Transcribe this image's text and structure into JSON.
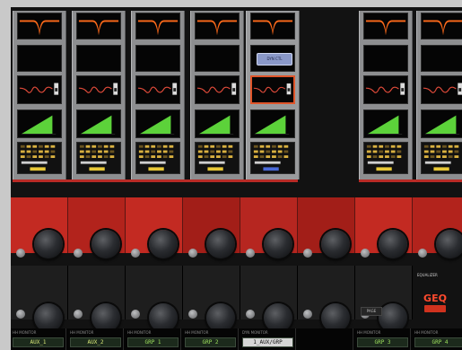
{
  "colors": {
    "accent": "#e0552a",
    "red": "#c0302a",
    "green": "#5cd23a",
    "orange": "#ff6a1a"
  },
  "strips": [
    {
      "id": "ch1",
      "selected": false
    },
    {
      "id": "ch2",
      "selected": false
    },
    {
      "id": "ch3",
      "selected": false
    },
    {
      "id": "ch4",
      "selected": false
    },
    {
      "id": "ch5",
      "selected": true,
      "dyn_label": "DYN CTL"
    },
    {
      "id": "ch6",
      "selected": false
    },
    {
      "id": "ch7",
      "selected": false
    }
  ],
  "names": [
    {
      "top": "HH MONITOR",
      "name": "AUX_1"
    },
    {
      "top": "HH MONITOR",
      "name": "AUX_2"
    },
    {
      "top": "HH MONITOR",
      "name": "GRP 1"
    },
    {
      "top": "HH MONITOR",
      "name": "GRP 2"
    },
    {
      "top": "DYN MONITOR",
      "name": "1_AUX/GRP"
    },
    {
      "top": "",
      "name": ""
    },
    {
      "top": "HH MONITOR",
      "name": "GRP 3"
    },
    {
      "top": "HH MONITOR",
      "name": "GRP 4"
    }
  ],
  "geq": {
    "label": "GEQ",
    "eq_label": "EQUALIZER"
  },
  "page_button": "PAGE"
}
